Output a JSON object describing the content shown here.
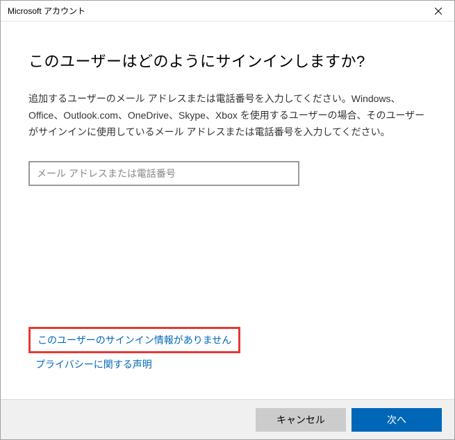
{
  "titlebar": {
    "title": "Microsoft アカウント"
  },
  "main": {
    "heading": "このユーザーはどのようにサインインしますか?",
    "description": "追加するユーザーのメール アドレスまたは電話番号を入力してください。Windows、Office、Outlook.com、OneDrive、Skype、Xbox を使用するユーザーの場合、そのユーザーがサインインに使用しているメール アドレスまたは電話番号を入力してください。",
    "input": {
      "placeholder": "メール アドレスまたは電話番号",
      "value": ""
    }
  },
  "links": {
    "no_signin_info": "このユーザーのサインイン情報がありません",
    "privacy": "プライバシーに関する声明"
  },
  "footer": {
    "cancel": "キャンセル",
    "next": "次へ"
  }
}
